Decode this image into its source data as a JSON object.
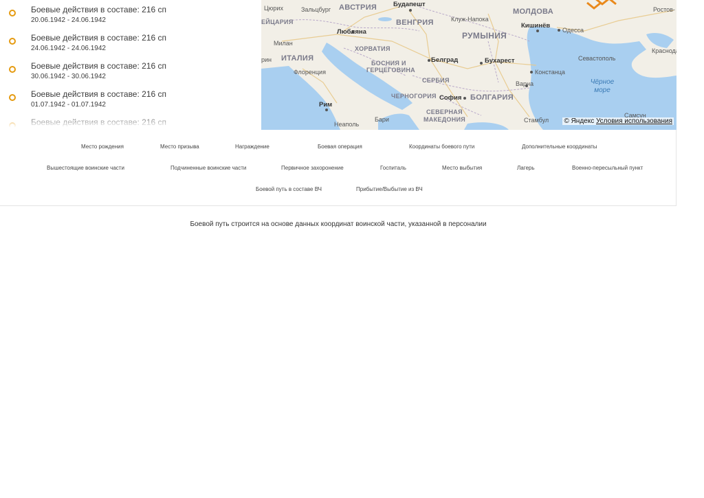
{
  "events": [
    {
      "title": "Боевые действия в составе: 216 сп",
      "dates": "20.06.1942 - 24.06.1942"
    },
    {
      "title": "Боевые действия в составе: 216 сп",
      "dates": "24.06.1942 - 24.06.1942"
    },
    {
      "title": "Боевые действия в составе: 216 сп",
      "dates": "30.06.1942 - 30.06.1942"
    },
    {
      "title": "Боевые действия в составе: 216 сп",
      "dates": "01.07.1942 - 01.07.1942"
    },
    {
      "title": "Боевые действия в составе: 216 сп",
      "dates": ""
    }
  ],
  "map": {
    "labels": {
      "cyurih": "Цюрих",
      "zalcburg": "Зальцбург",
      "avstriya": "АВСТРИЯ",
      "budapesht": "Будапешт",
      "moldova": "МОЛДОВА",
      "rostov": "Ростов-",
      "shveycariya": "ЕЙЦАРИЯ",
      "vengriya": "ВЕНГРИЯ",
      "kluzh": "Клуж-Напока",
      "kishinev": "Кишинёв",
      "odessa": "Одесса",
      "lyublyana": "Любляна",
      "rumyniya": "РУМЫНИЯ",
      "milan": "Милан",
      "horvatiya": "ХОРВАТИЯ",
      "krasnodar": "Краснода",
      "rin": "рин",
      "italiya": "ИТАЛИЯ",
      "bosniya1": "БОСНИЯ И",
      "gerc": "ГЕРЦЕГОВИНА",
      "belgrad": "Белград",
      "buharest": "Бухарест",
      "sevastopol": "Севастополь",
      "florenciya": "Флоренция",
      "konstanca": "Констанца",
      "serbiya": "СЕРБИЯ",
      "varna": "Варна",
      "chernoe": "Чёрное",
      "more": "море",
      "chernogoriya": "ЧЕРНОГОРИЯ",
      "sofiya": "София",
      "bolgariya": "БОЛГАРИЯ",
      "rim": "Рим",
      "severnaya": "СЕВЕРНАЯ",
      "makedoniya": "МАКЕДОНИЯ",
      "neapol": "Неаполь",
      "bari": "Бари",
      "stambul": "Стамбул",
      "samsun": "Самсун"
    },
    "copyright": "© Яндекс",
    "terms": "Условия использования",
    "colors": {
      "water": "#a9cff0",
      "land": "#f2efe7",
      "route": "#e9891b"
    }
  },
  "legend": [
    "Место рождения",
    "Место призыва",
    "Награждение",
    "Боевая операция",
    "Координаты боевого пути",
    "Дополнительные координаты",
    "Вышестоящие воинские части",
    "Подчиненные воинские части",
    "Первичное захоронение",
    "Госпиталь",
    "Место выбытия",
    "Лагерь",
    "Военно-пересыльный пункт",
    "Боевой путь в составе ВЧ",
    "Прибытие/Выбытие из ВЧ"
  ],
  "note": "Боевой путь строится на основе данных координат воинской части, указанной в персоналии"
}
